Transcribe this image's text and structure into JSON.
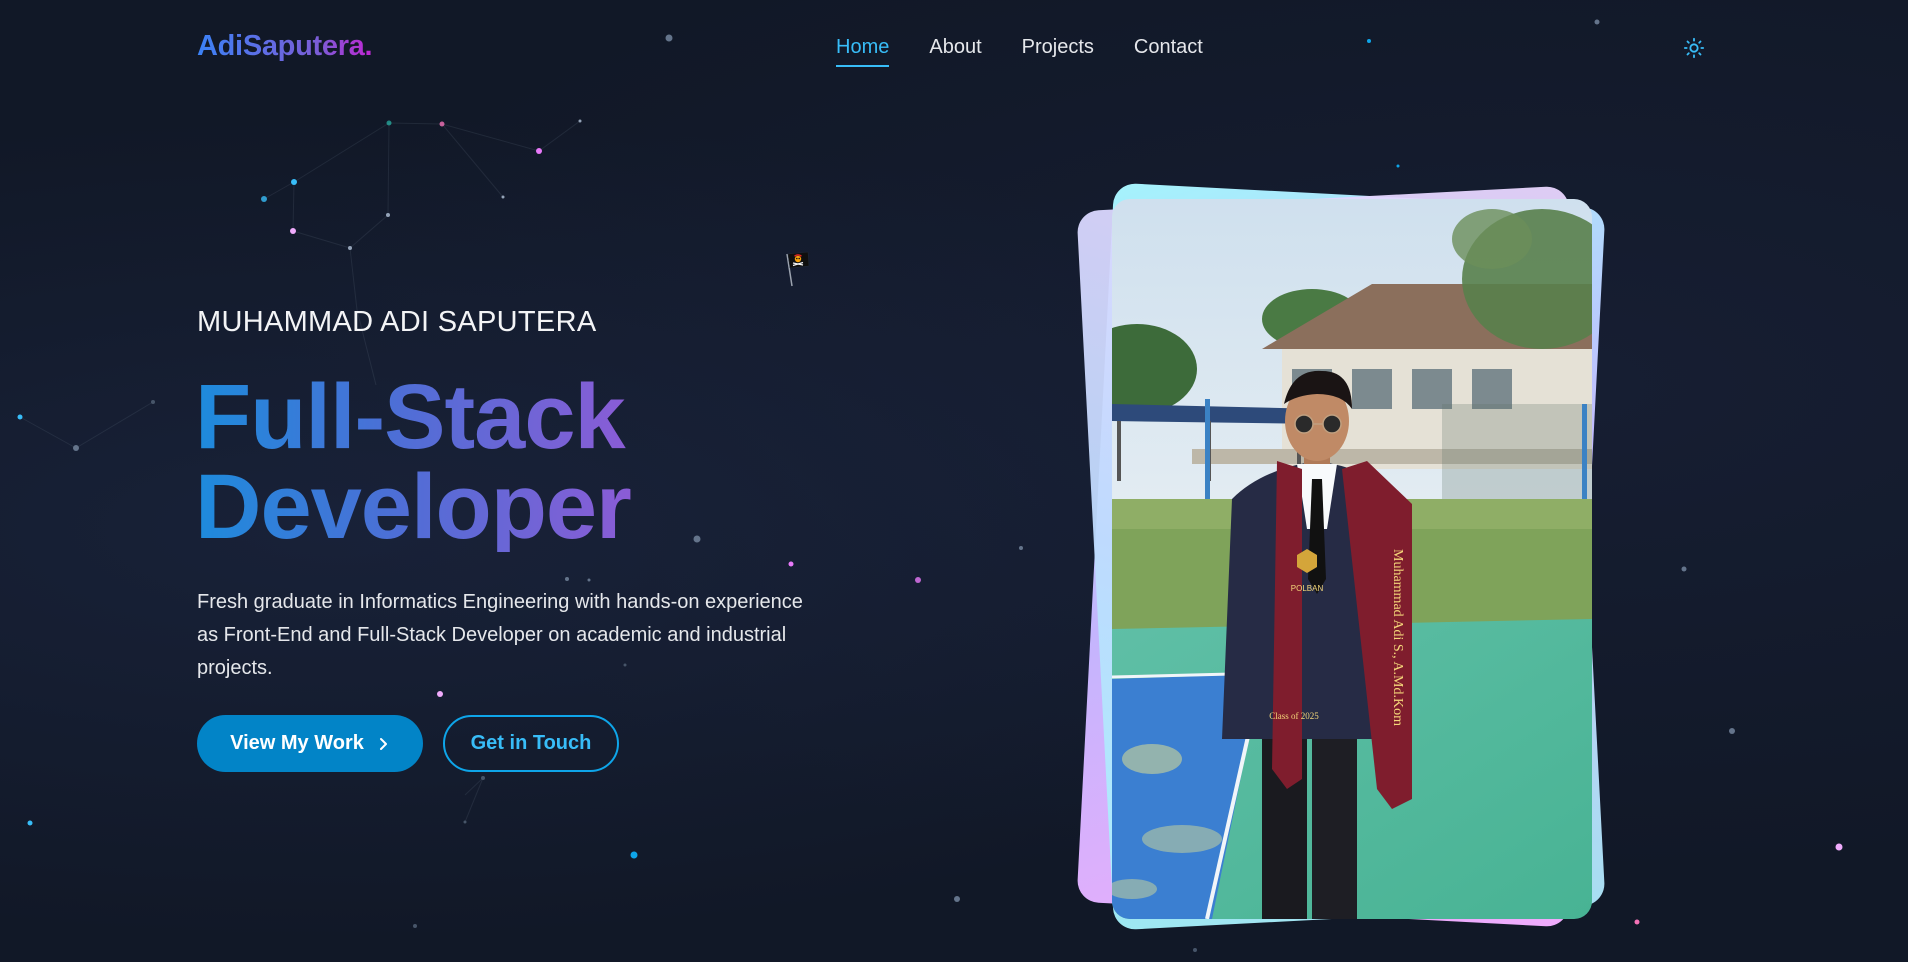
{
  "header": {
    "logo": "AdiSaputera.",
    "nav": [
      {
        "label": "Home",
        "active": true
      },
      {
        "label": "About",
        "active": false
      },
      {
        "label": "Projects",
        "active": false
      },
      {
        "label": "Contact",
        "active": false
      }
    ],
    "theme_icon": "sun-icon"
  },
  "hero": {
    "pre_title": "MUHAMMAD ADI SAPUTERA",
    "title_line1": "Full-Stack",
    "title_line2": "Developer",
    "description": "Fresh graduate in Informatics Engineering with hands-on experience as Front-End and Full-Stack Developer on academic and industrial projects.",
    "primary_button": "View My Work",
    "secondary_button": "Get in Touch",
    "primary_icon": "chevron-right-icon",
    "flag_icon": "pirate-flag-icon"
  },
  "photo": {
    "stole_text": "Muhammad Adi S., A.Md.Kom",
    "badge_text": "POLBAN",
    "class_text": "Class of 2025"
  },
  "colors": {
    "background": "#111827",
    "accent": "#38bdf8",
    "primary_button": "#0284c7",
    "gradient_start": "#1d8bdc",
    "gradient_end": "#8b5cd6"
  }
}
